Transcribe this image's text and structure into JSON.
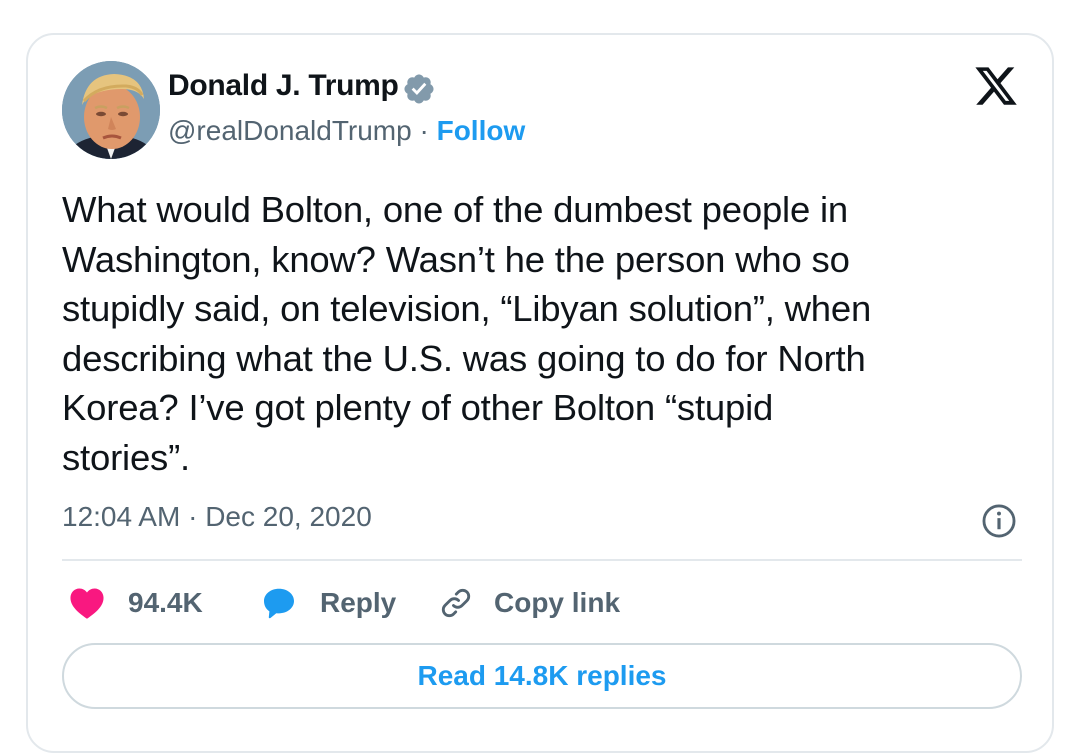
{
  "author": {
    "name": "Donald J. Trump",
    "handle": "@realDonaldTrump",
    "separator": " · ",
    "follow_label": "Follow",
    "verified": true
  },
  "tweet": {
    "text": "What would Bolton, one of the dumbest people in\nWashington, know? Wasn’t he the person who so\nstupidly said, on television, “Libyan solution”, when\ndescribing what the U.S. was going to do for North\nKorea? I’ve got plenty of other Bolton “stupid\nstories”.",
    "time": "12:04 AM",
    "separator": " · ",
    "date": "Dec 20, 2020"
  },
  "actions": {
    "likes_count": "94.4K",
    "reply_label": "Reply",
    "copy_link_label": "Copy link"
  },
  "read_replies_label": "Read 14.8K replies",
  "icons": {
    "platform": "x-logo-icon",
    "verified": "verified-badge-icon",
    "info": "info-icon",
    "like": "heart-icon",
    "reply": "speech-bubble-icon",
    "copy_link": "link-icon"
  },
  "colors": {
    "accent": "#1d9bf0",
    "like": "#f91880",
    "text": "#0f1419",
    "secondary_text": "#536471",
    "border": "#e3e8ec"
  }
}
